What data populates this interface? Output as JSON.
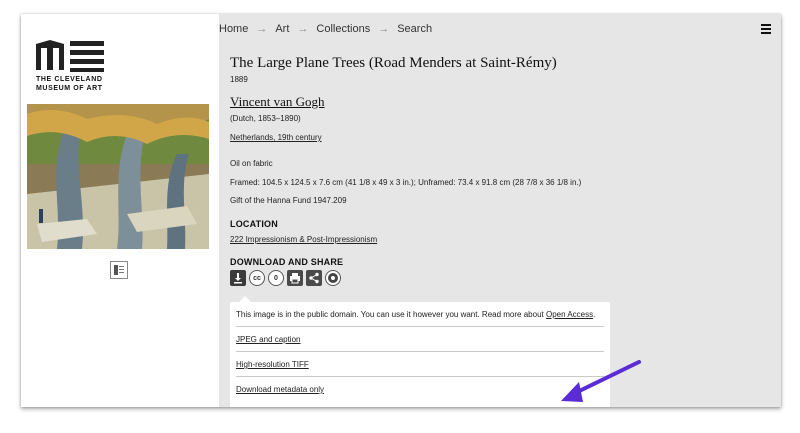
{
  "museum": {
    "name_line1": "THE CLEVELAND",
    "name_line2": "MUSEUM OF ART"
  },
  "breadcrumb": [
    "Home",
    "Art",
    "Collections",
    "Search"
  ],
  "breadcrumb_separator": "→",
  "artwork": {
    "title": "The Large Plane Trees (Road Menders at Saint-Rémy)",
    "year": "1889",
    "artist": "Vincent van Gogh",
    "nationality": "(Dutch, 1853–1890)",
    "culture": "Netherlands, 19th century",
    "medium": "Oil on fabric",
    "dimensions": "Framed: 104.5 x 124.5 x 7.6 cm (41 1/8 x 49 x 3 in.); Unframed: 73.4 x 91.8 cm (28 7/8 x 36 1/8 in.)",
    "credit": "Gift of the Hanna Fund 1947.209"
  },
  "location": {
    "heading": "LOCATION",
    "gallery": "222 Impressionism & Post-Impressionism"
  },
  "share": {
    "heading": "DOWNLOAD AND SHARE",
    "icons": [
      "download-icon",
      "creative-commons-icon",
      "public-domain-icon",
      "print-icon",
      "share-icon",
      "aperture-icon"
    ],
    "icon_glyphs": {
      "cc": "cc",
      "zero": "0"
    }
  },
  "download_panel": {
    "notice_text": "This image is in the public domain. You can use it however you want. Read more about",
    "notice_link": "Open Access",
    "notice_end": ".",
    "options": [
      "JPEG and caption",
      "High-resolution TIFF",
      "Download metadata only"
    ]
  },
  "colors": {
    "annotation_arrow": "#5a2bd6",
    "right_panel_bg": "#e6e6e6"
  }
}
